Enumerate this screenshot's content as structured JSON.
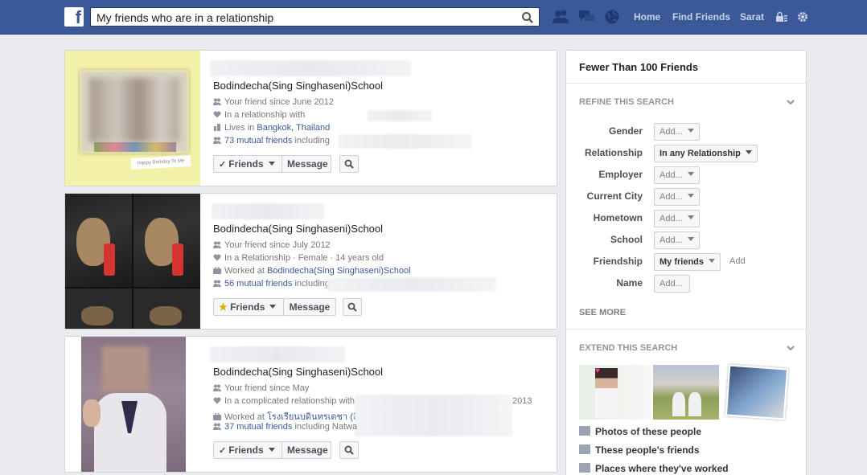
{
  "search": {
    "query": "My friends who are in a relationship"
  },
  "nav": {
    "home": "Home",
    "find_friends": "Find Friends",
    "user": "Sarat"
  },
  "results": [
    {
      "school": "Bodindecha(Sing Singhaseni)School",
      "line1": "Your friend since June 2012",
      "line2": "In a relationship with",
      "line3_prefix": "Lives in ",
      "line3_link": "Bangkok, Thailand",
      "line4_link": "73 mutual friends",
      "line4_suffix": " including",
      "friends_label": "Friends",
      "message_label": "Message"
    },
    {
      "school": "Bodindecha(Sing Singhaseni)School",
      "line1": "Your friend since July 2012",
      "line2": "In a Relationship · Female · 14 years old",
      "line3_prefix": "Worked at ",
      "line3_link": "Bodindecha(Sing Singhaseni)School",
      "line4_link": "56 mutual friends",
      "line4_suffix": " including",
      "friends_label": "Friends",
      "message_label": "Message"
    },
    {
      "school": "Bodindecha(Sing Singhaseni)School",
      "line1": "Your friend since May",
      "line2": "In a complicated relationship with",
      "line2_tail": "2013",
      "line3_prefix": "Worked at ",
      "line3_link": "โรงเรียนบดินทรเดชา (สิ",
      "line4_link": "37 mutual friends",
      "line4_suffix": " including Natwa",
      "friends_label": "Friends",
      "message_label": "Message"
    }
  ],
  "sidebar": {
    "title": "Fewer Than 100 Friends",
    "refine_title": "REFINE THIS SEARCH",
    "filters": [
      {
        "label": "Gender",
        "value": "Add..."
      },
      {
        "label": "Relationship",
        "value": "In any Relationship"
      },
      {
        "label": "Employer",
        "value": "Add..."
      },
      {
        "label": "Current City",
        "value": "Add..."
      },
      {
        "label": "Hometown",
        "value": "Add..."
      },
      {
        "label": "School",
        "value": "Add..."
      },
      {
        "label": "Friendship",
        "value": "My friends",
        "extra": "Add"
      },
      {
        "label": "Name",
        "value": "Add..."
      }
    ],
    "see_more": "SEE MORE",
    "extend_title": "EXTEND THIS SEARCH",
    "extend_links": [
      "Photos of these people",
      "These people's friends",
      "Places where they've worked"
    ]
  },
  "colors": {
    "brand": "#3b5998",
    "page_bg": "#e9ebee"
  }
}
